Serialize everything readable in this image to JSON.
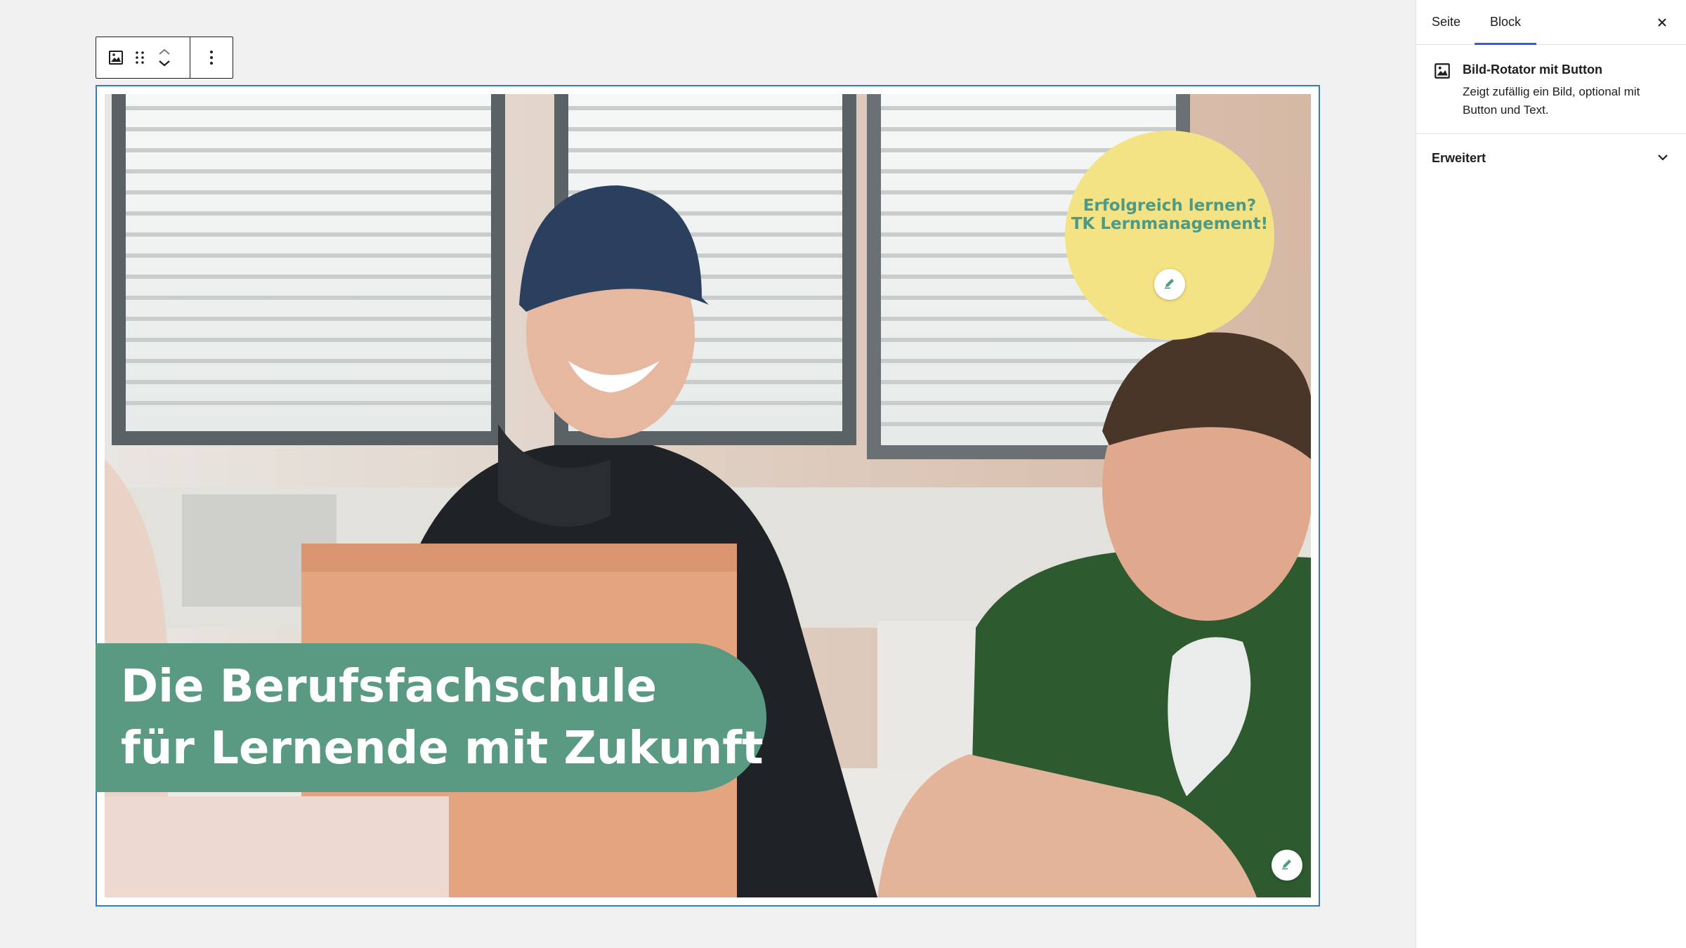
{
  "toolbar": {
    "block_type_icon": "image-icon",
    "drag_icon": "drag-handle-icon",
    "move_up_icon": "chevron-up-icon",
    "move_down_icon": "chevron-down-icon",
    "options_icon": "more-vertical-icon"
  },
  "block": {
    "caption_lines": [
      "Die Berufsfachschule",
      "für Lernende mit Zukunft"
    ],
    "promo_lines": [
      "Erfolgreich lernen?",
      "TK Lernmanagement!"
    ],
    "edit_icon": "pencil-icon"
  },
  "sidebar": {
    "tabs": [
      {
        "label": "Seite",
        "active": false
      },
      {
        "label": "Block",
        "active": true
      }
    ],
    "close_icon": "close-icon",
    "block_card": {
      "icon": "image-icon",
      "title": "Bild-Rotator mit Button",
      "description": "Zeigt zufällig ein Bild, optional mit Button und Text."
    },
    "panels": [
      {
        "title": "Erweitert",
        "icon": "chevron-down-icon",
        "expanded": false
      }
    ]
  },
  "colors": {
    "caption_bg": "#5b9a82",
    "promo_bg": "#f4e384",
    "promo_text": "#4e9a85",
    "selection_border": "#3b78c4",
    "tab_accent": "#3858e9"
  }
}
